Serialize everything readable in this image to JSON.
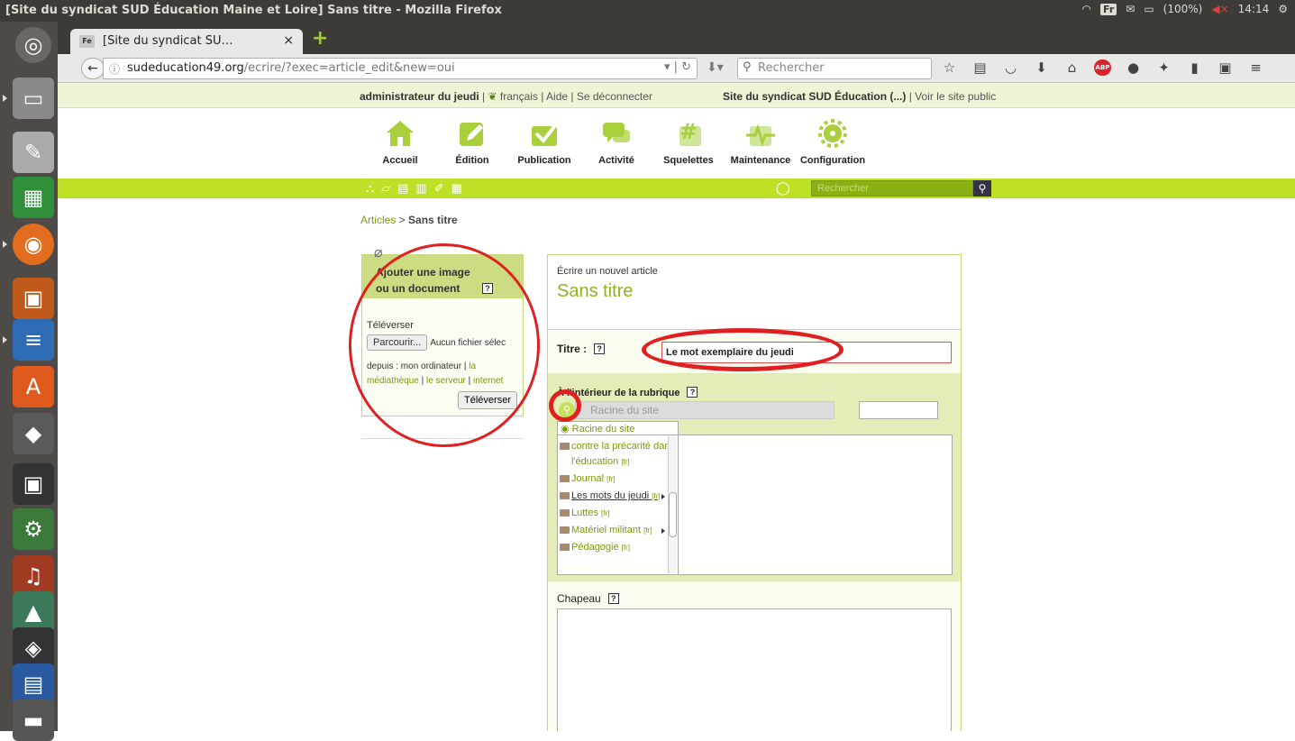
{
  "system": {
    "window_title": "[Site du syndicat SUD Éducation Maine et Loire] Sans titre - Mozilla Firefox",
    "keyboard": "Fr",
    "battery": "(100%)",
    "clock": "14:14"
  },
  "browser": {
    "tab_label": "[Site du syndicat SU…",
    "tab_favicon_text": "Fe",
    "url_host": "sudeducation49.org",
    "url_path": "/ecrire/?exec=article_edit&new=oui",
    "search_placeholder": "Rechercher"
  },
  "adminbar": {
    "user": "administrateur du jeudi",
    "lang": "français",
    "help": "Aide",
    "logout": "Se déconnecter",
    "site": "Site du syndicat SUD Éducation (...)",
    "public": "Voir le site public"
  },
  "nav": [
    {
      "label": "Accueil"
    },
    {
      "label": "Édition"
    },
    {
      "label": "Publication"
    },
    {
      "label": "Activité"
    },
    {
      "label": "Squelettes"
    },
    {
      "label": "Maintenance"
    },
    {
      "label": "Configuration"
    }
  ],
  "toolbar": {
    "search_placeholder": "Rechercher"
  },
  "breadcrumb": {
    "parent": "Articles",
    "current": "Sans titre"
  },
  "docbox": {
    "title": "Ajouter une image ou un document",
    "upload_label": "Téléverser",
    "browse_button": "Parcourir...",
    "no_file": "Aucun fichier sélec",
    "from_prefix": "depuis : mon ordinateur | ",
    "from_media": "la médiathèque",
    "from_server": "le serveur",
    "from_internet": "internet",
    "submit": "Téléverser"
  },
  "form": {
    "subtitle": "Écrire un nouvel article",
    "title": "Sans titre",
    "title_label": "Titre :",
    "title_value": "Le mot exemplaire du jeudi",
    "rubrique_label": "À l'intérieur de la rubrique",
    "rubrique_value": "Racine du site",
    "dropdown_head": "Racine du site",
    "chapeau_label": "Chapeau"
  },
  "rubriques": [
    {
      "label": "contre la précarité dans l'éducation",
      "lang": "[fr]"
    },
    {
      "label": "Journal",
      "lang": "[fr]"
    },
    {
      "label": "Les mots du jeudi",
      "lang": "[fr]"
    },
    {
      "label": "Luttes",
      "lang": "[fr]"
    },
    {
      "label": "Matériel militant",
      "lang": "[fr]"
    },
    {
      "label": "Pédagogie",
      "lang": "[fr]"
    }
  ],
  "colors": {
    "accent": "#bde127",
    "link": "#7a9a0c",
    "annotation": "#e02020"
  }
}
